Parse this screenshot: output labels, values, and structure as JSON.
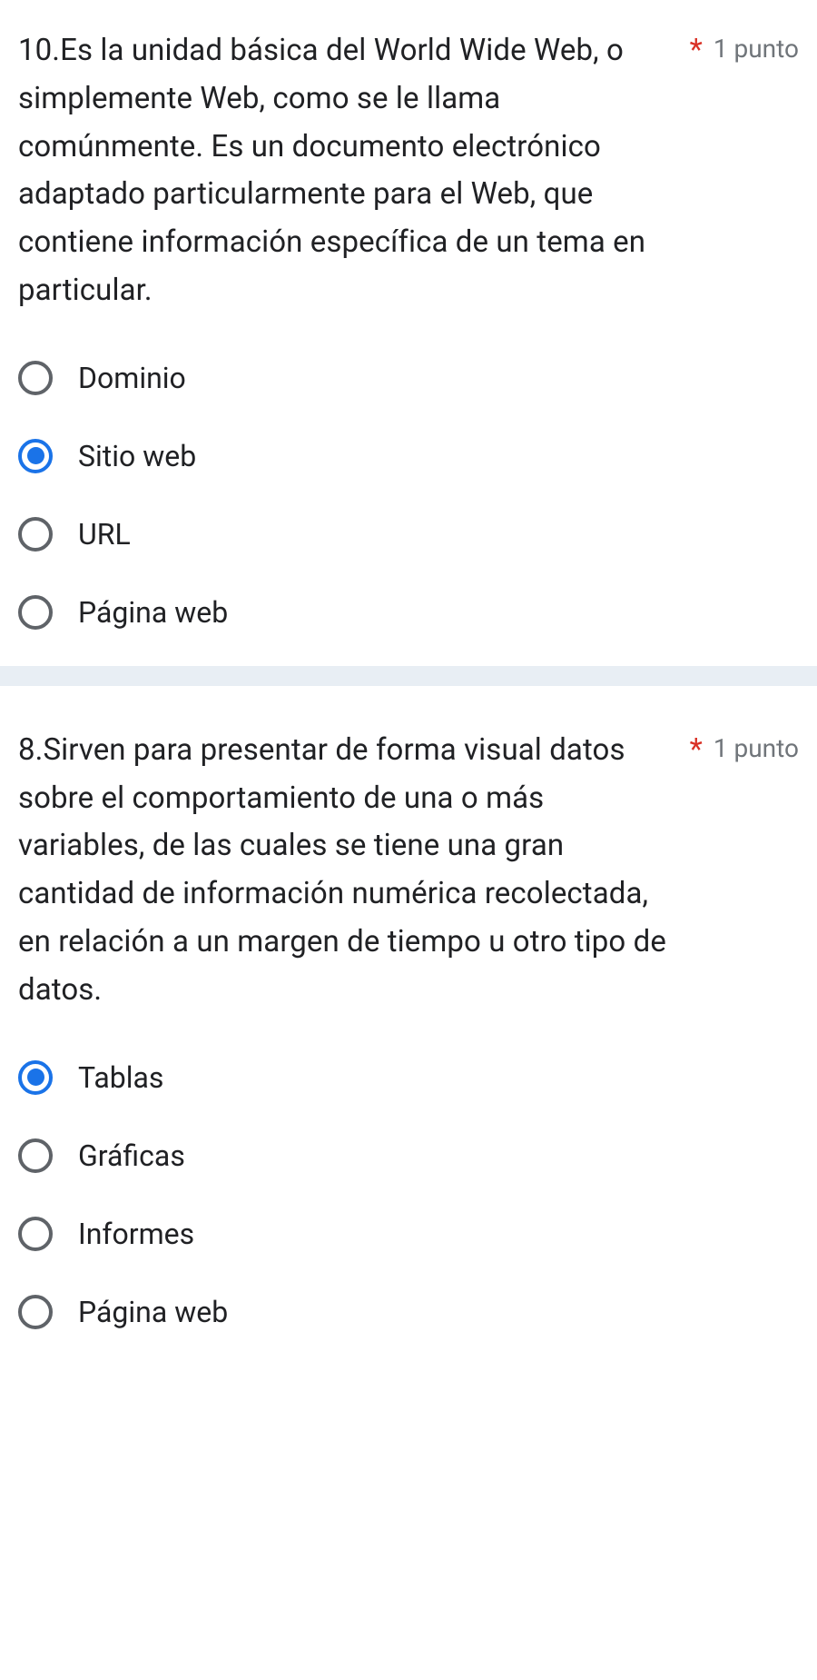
{
  "questions": [
    {
      "title": "10.Es la unidad básica del World Wide Web, o simplemente Web, como se le llama comúnmente. Es un documento electrónico adaptado particularmente para el Web, que contiene información específica de un tema en particular.",
      "required_marker": "*",
      "points": "1 punto",
      "options": [
        {
          "label": "Dominio",
          "selected": false
        },
        {
          "label": "Sitio web",
          "selected": true
        },
        {
          "label": "URL",
          "selected": false
        },
        {
          "label": "Página web",
          "selected": false
        }
      ]
    },
    {
      "title": "8.Sirven para presentar de forma visual datos sobre el comportamiento de una o más variables, de las cuales se tiene una gran cantidad de información numérica recolectada, en relación a un margen de tiempo u otro tipo de datos.",
      "required_marker": "*",
      "points": "1 punto",
      "options": [
        {
          "label": "Tablas",
          "selected": true
        },
        {
          "label": "Gráficas",
          "selected": false
        },
        {
          "label": "Informes",
          "selected": false
        },
        {
          "label": "Página web",
          "selected": false
        }
      ]
    }
  ]
}
